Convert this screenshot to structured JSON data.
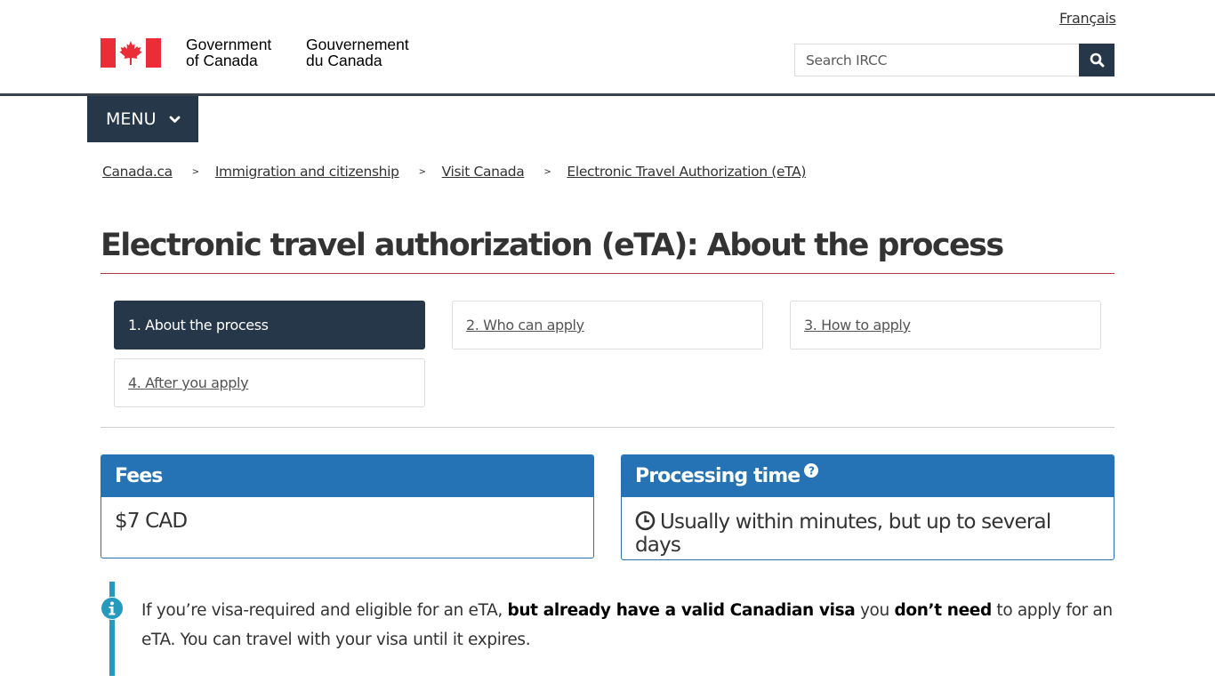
{
  "header": {
    "wordmark_en_line1": "Government",
    "wordmark_en_line2": "of Canada",
    "wordmark_fr_line1": "Gouvernement",
    "wordmark_fr_line2": "du Canada",
    "language_link": "Français",
    "search_placeholder": "Search IRCC",
    "search_icon": "magnifier-icon",
    "flag_colors": {
      "red": "#eb2d37",
      "white": "#ffffff"
    }
  },
  "menu": {
    "label": "MENU",
    "icon": "chevron-down-icon"
  },
  "breadcrumb": [
    {
      "label": "Canada.ca"
    },
    {
      "label": "Immigration and citizenship"
    },
    {
      "label": "Visit Canada"
    },
    {
      "label": "Electronic Travel Authorization (eTA)"
    }
  ],
  "page": {
    "title": "Electronic travel authorization (eTA): About the process"
  },
  "steps": [
    {
      "label": "1. About the process",
      "active": true
    },
    {
      "label": "2. Who can apply",
      "active": false
    },
    {
      "label": "3. How to apply",
      "active": false
    },
    {
      "label": "4. After you apply",
      "active": false
    }
  ],
  "panels": {
    "fees": {
      "heading": "Fees",
      "value": "$7 CAD"
    },
    "processing": {
      "heading": "Processing time",
      "help_icon": "question-circle-icon",
      "value": "Usually within minutes, but up to several days",
      "value_icon": "clock-icon"
    }
  },
  "alert": {
    "icon": "info-circle-icon",
    "parts": {
      "t1": "If you’re visa-required and eligible for an eTA, ",
      "b1": "but already have a valid Canadian visa",
      "t2": " you ",
      "b2": "don’t need",
      "t3": " to apply for an eTA. You can travel with your visa until it expires."
    }
  },
  "colors": {
    "primary_dark": "#26374a",
    "panel_blue": "#2572b4",
    "title_rule": "#af3c43",
    "alert_info": "#269abc"
  }
}
